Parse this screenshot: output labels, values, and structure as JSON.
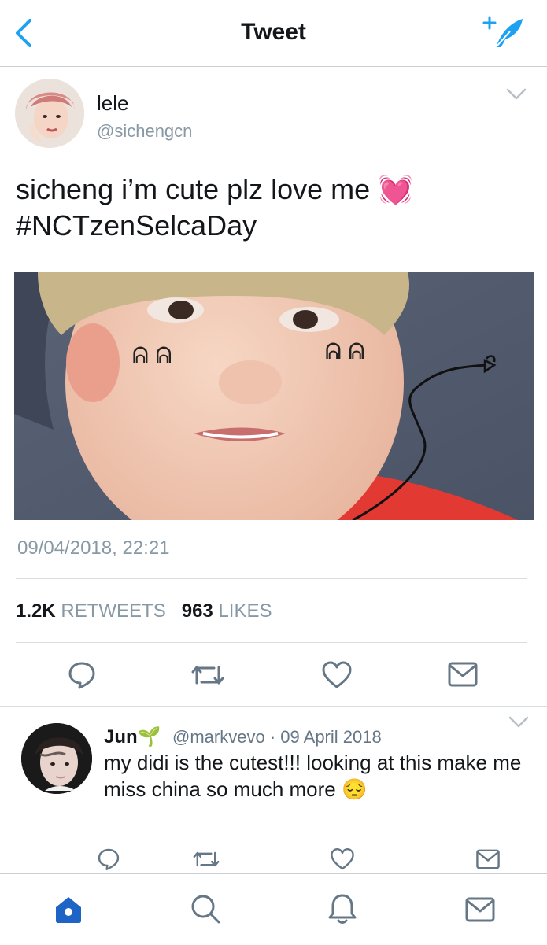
{
  "header": {
    "title": "Tweet",
    "back_icon": "chevron-left-icon",
    "compose_icon": "compose-quill-icon",
    "accent": "#1da1f2"
  },
  "tweet": {
    "display_name": "lele",
    "handle": "@sichengcn",
    "text_line1": "sicheng i’m cute plz love me",
    "text_emoji": "💓",
    "text_line2": "#NCTzenSelcaDay",
    "timestamp": "09/04/2018, 22:21",
    "retweets_count": "1.2K",
    "retweets_label": "RETWEETS",
    "likes_count": "963",
    "likes_label": "LIKES",
    "photo_drawn_text": "ᕱ ᕱ"
  },
  "reply": {
    "display_name": "Jun",
    "name_emoji": "🌱",
    "handle": "@markvevo",
    "separator": "·",
    "date": "09 April 2018",
    "text": "my didi is the cutest!!! looking at this make me miss china so much more",
    "text_emoji": "😔"
  },
  "tabbar": {
    "items": [
      "home-icon",
      "search-icon",
      "notifications-icon",
      "messages-icon"
    ],
    "active": "home-icon"
  }
}
